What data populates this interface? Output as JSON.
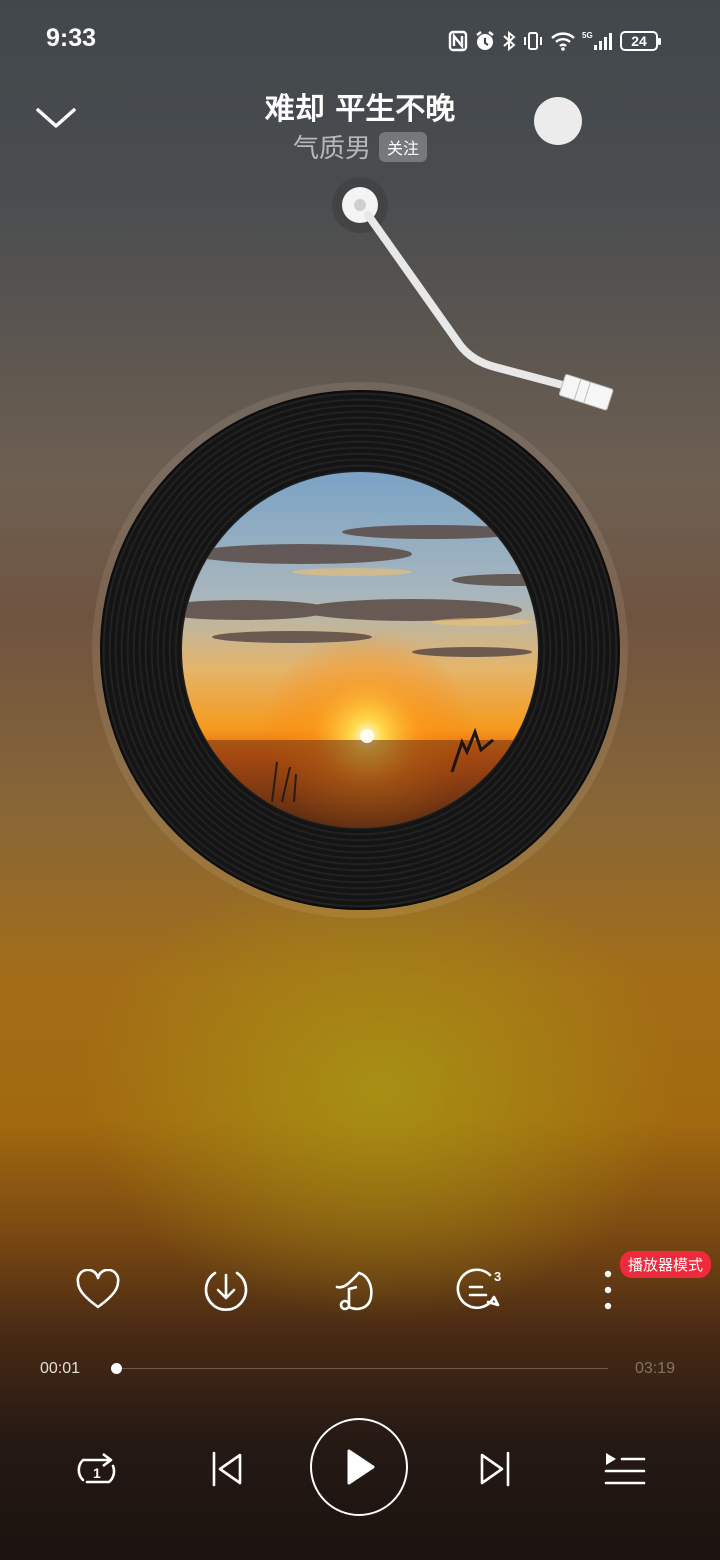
{
  "status_bar": {
    "time": "9:33",
    "battery": "24",
    "network": "5G"
  },
  "song": {
    "title": "难却 平生不晚",
    "artist": "气质男",
    "follow_label": "关注"
  },
  "actions": {
    "comment_count": "3",
    "player_mode_badge": "播放器模式"
  },
  "progress": {
    "current": "00:01",
    "duration": "03:19",
    "fraction": 0.005
  },
  "icons": [
    "collapse-chevron-icon",
    "heart-icon",
    "download-icon",
    "sound-effect-icon",
    "comment-icon",
    "more-icon",
    "repeat-one-icon",
    "previous-icon",
    "play-icon",
    "next-icon",
    "playlist-icon"
  ],
  "colors": {
    "accent_badge": "#ef2a3c"
  }
}
